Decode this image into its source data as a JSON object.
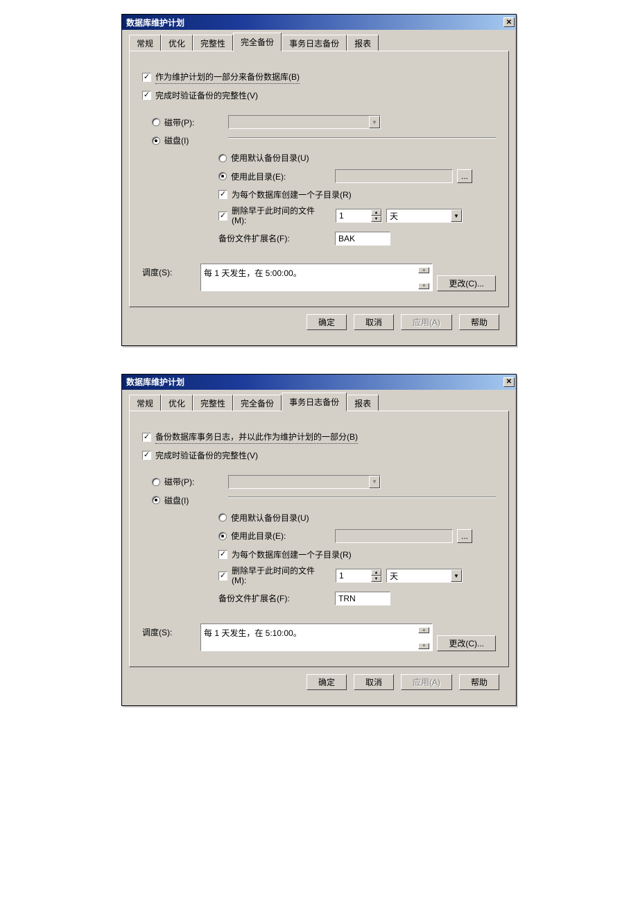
{
  "dialogs": [
    {
      "title": "数据库维护计划",
      "tabs": [
        "常规",
        "优化",
        "完整性",
        "完全备份",
        "事务日志备份",
        "报表"
      ],
      "active_tab": "完全备份",
      "backup_as_part_label": "作为维护计划的一部分来备份数据库(B)",
      "verify_integrity_label": "完成时验证备份的完整性(V)",
      "tape_label": "磁带(P):",
      "disk_label": "磁盘(I)",
      "use_default_dir_label": "使用默认备份目录(U)",
      "use_this_dir_label": "使用此目录(E):",
      "create_subdir_label": "为每个数据库创建一个子目录(R)",
      "delete_older_label_line1": "删除早于此时间的文件",
      "delete_older_label_line2": "(M):",
      "delete_older_value": "1",
      "delete_older_unit": "天",
      "ext_label": "备份文件扩展名(F):",
      "ext_value": "BAK",
      "dir_value": "",
      "schedule_label": "调度(S):",
      "schedule_text": "每 1 天发生，在 5:00:00。",
      "change_btn": "更改(C)...",
      "browse_btn": "...",
      "btn_ok": "确定",
      "btn_cancel": "取消",
      "btn_apply": "应用(A)",
      "btn_help": "帮助",
      "chk_backup_as_part": true,
      "chk_verify": true,
      "radio_tape": false,
      "radio_disk": true,
      "radio_default_dir": false,
      "radio_this_dir": true,
      "chk_subdir": true,
      "chk_delete_older": true
    },
    {
      "title": "数据库维护计划",
      "tabs": [
        "常规",
        "优化",
        "完整性",
        "完全备份",
        "事务日志备份",
        "报表"
      ],
      "active_tab": "事务日志备份",
      "backup_as_part_label": "备份数据库事务日志，并以此作为维护计划的一部分(B)",
      "verify_integrity_label": "完成时验证备份的完整性(V)",
      "tape_label": "磁带(P):",
      "disk_label": "磁盘(I)",
      "use_default_dir_label": "使用默认备份目录(U)",
      "use_this_dir_label": "使用此目录(E):",
      "create_subdir_label": "为每个数据库创建一个子目录(R)",
      "delete_older_label_line1": "删除早于此时间的文件",
      "delete_older_label_line2": "(M):",
      "delete_older_value": "1",
      "delete_older_unit": "天",
      "ext_label": "备份文件扩展名(F):",
      "ext_value": "TRN",
      "dir_value": "",
      "schedule_label": "调度(S):",
      "schedule_text": "每 1 天发生，在 5:10:00。",
      "change_btn": "更改(C)...",
      "browse_btn": "...",
      "btn_ok": "确定",
      "btn_cancel": "取消",
      "btn_apply": "应用(A)",
      "btn_help": "帮助",
      "chk_backup_as_part": true,
      "chk_verify": true,
      "radio_tape": false,
      "radio_disk": true,
      "radio_default_dir": false,
      "radio_this_dir": true,
      "chk_subdir": true,
      "chk_delete_older": true
    }
  ]
}
